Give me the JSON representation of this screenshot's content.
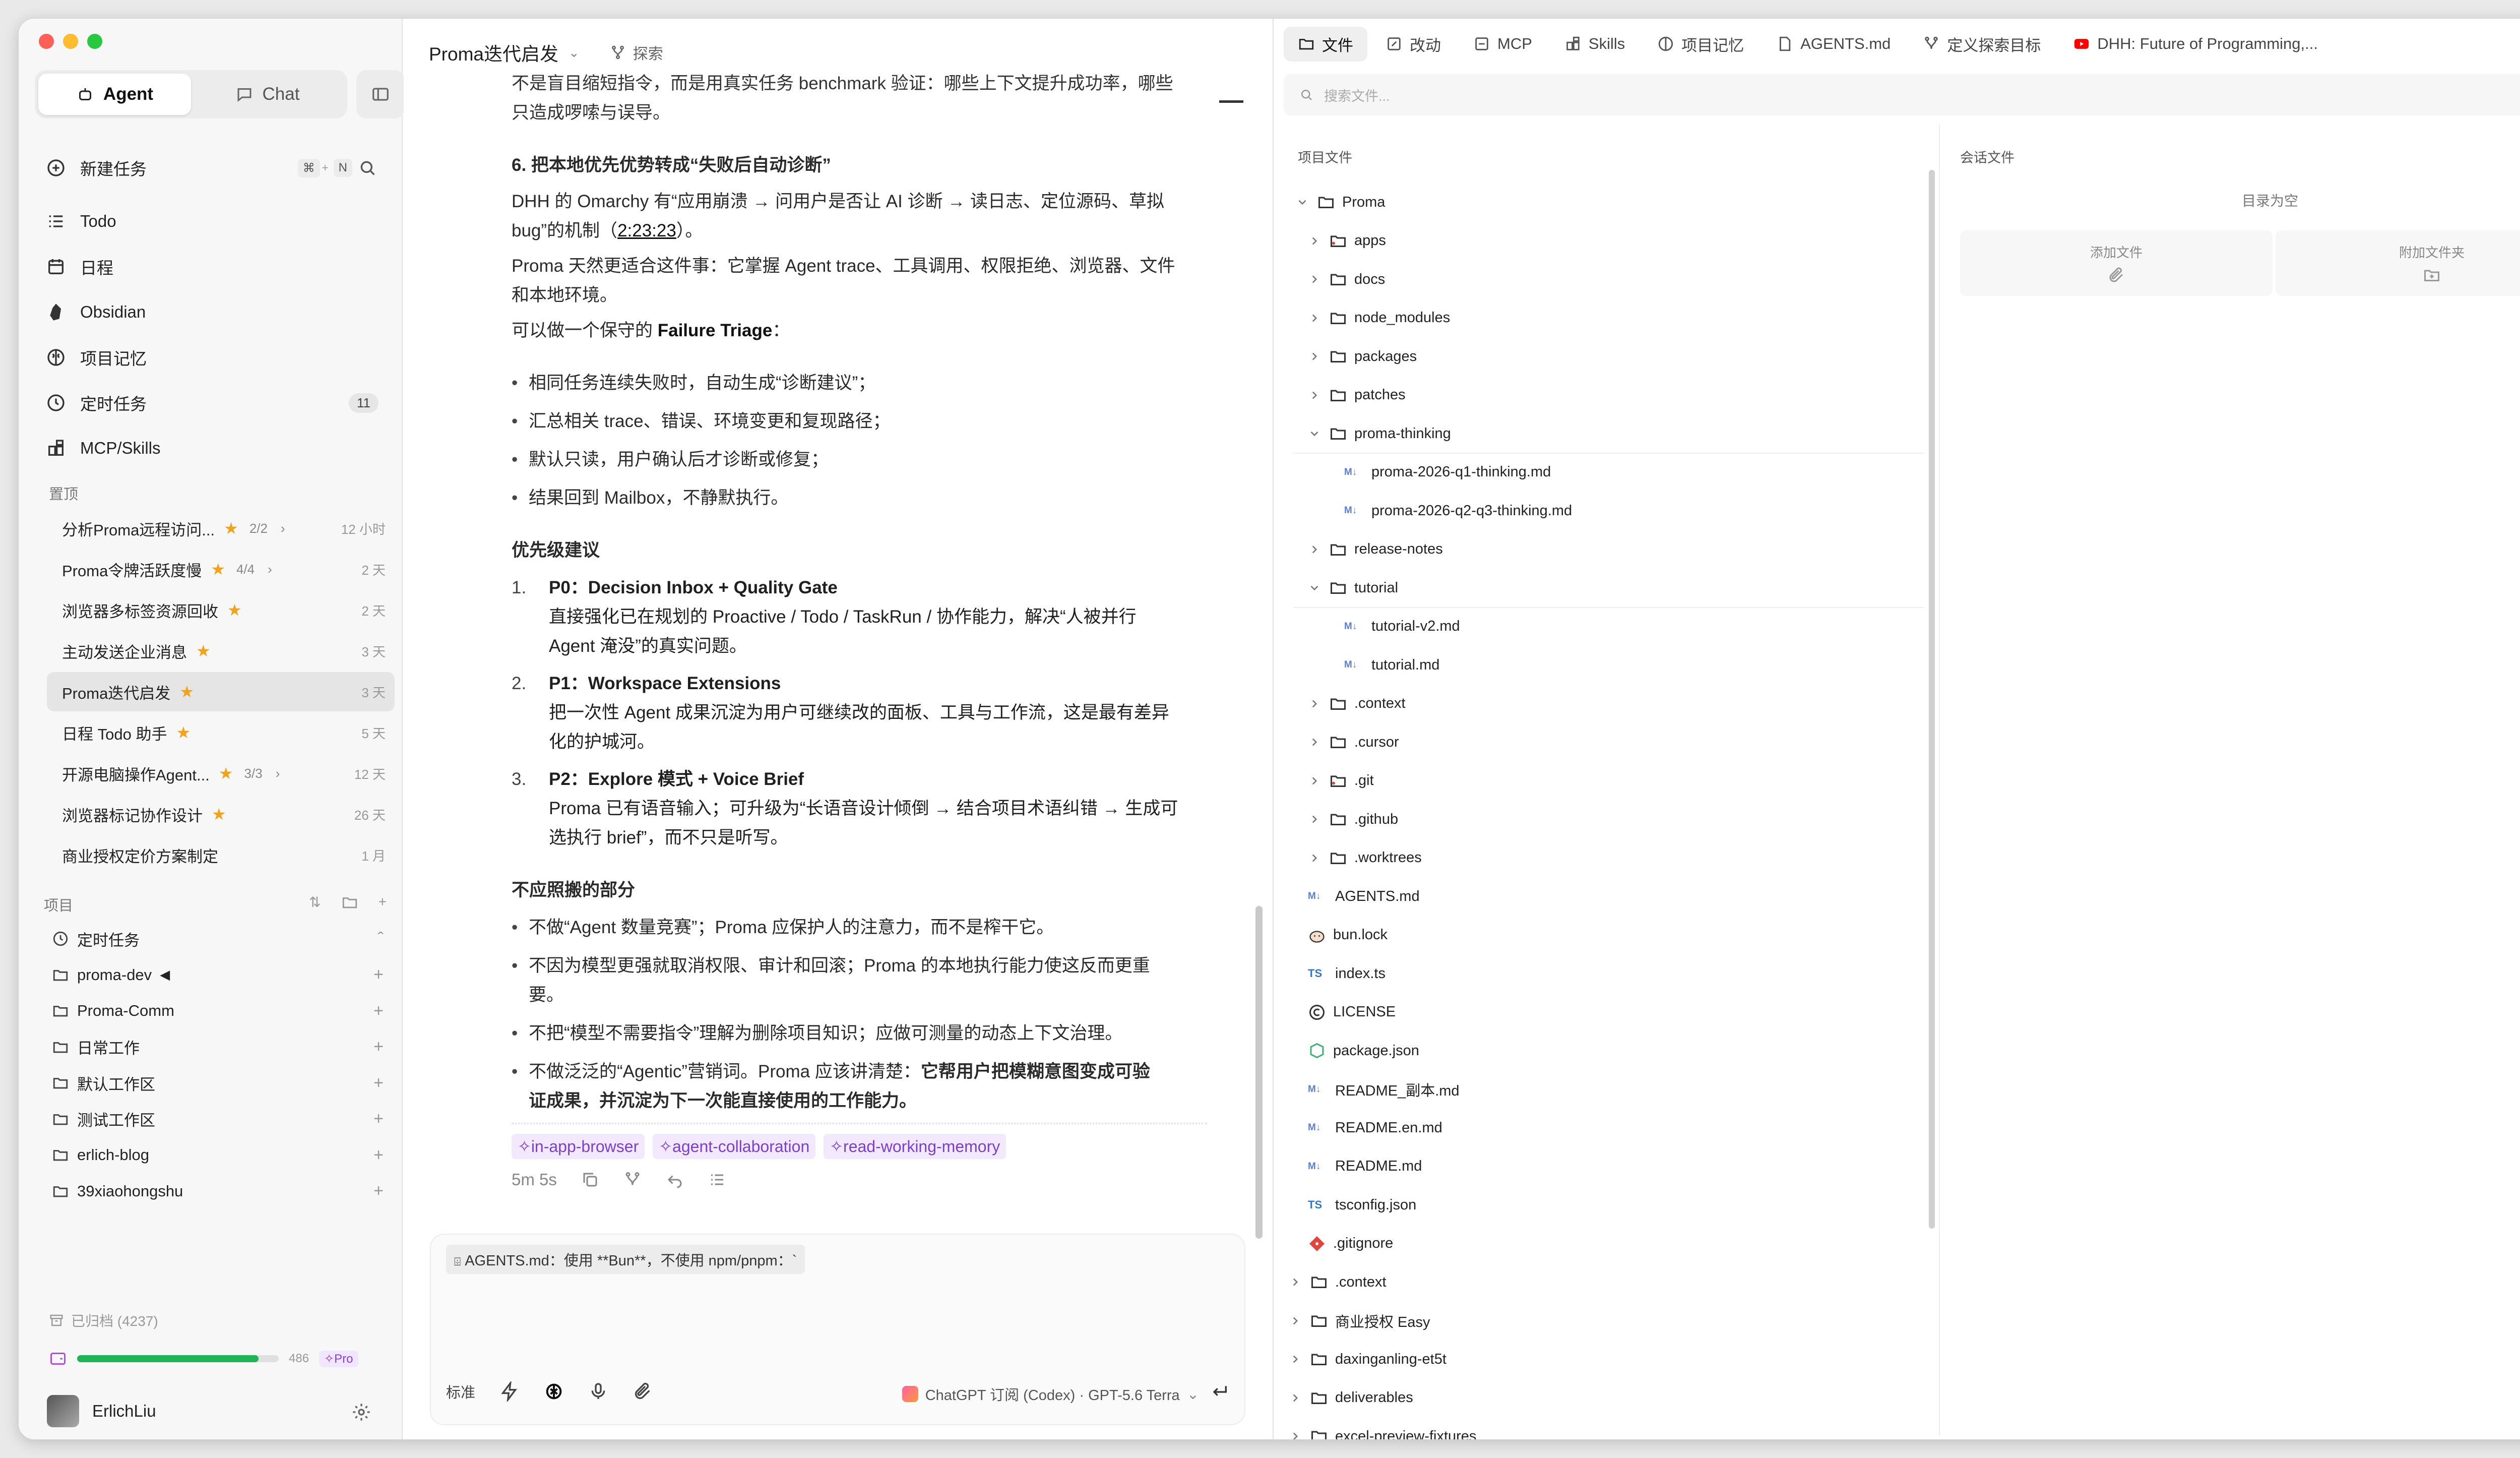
{
  "sidebar": {
    "tabs": {
      "agent": "Agent",
      "chat": "Chat"
    },
    "new_task": "新建任务",
    "kbd1": "⌘",
    "kbd_plus": "+",
    "kbd2": "N",
    "nav": [
      "Todo",
      "日程",
      "Obsidian",
      "项目记忆",
      "定时任务",
      "MCP/Skills"
    ],
    "timer_badge": "11",
    "pinned_title": "置顶",
    "pinned": [
      {
        "label": "分析Proma远程访问...",
        "star": true,
        "count": "2/2",
        "chev": true,
        "time": "12 小时"
      },
      {
        "label": "Proma令牌活跃度慢",
        "star": true,
        "count": "4/4",
        "chev": true,
        "time": "2 天"
      },
      {
        "label": "浏览器多标签资源回收",
        "star": true,
        "count": "",
        "chev": false,
        "time": "2 天"
      },
      {
        "label": "主动发送企业消息",
        "star": true,
        "count": "",
        "chev": false,
        "time": "3 天"
      },
      {
        "label": "Proma迭代启发",
        "star": true,
        "count": "",
        "chev": false,
        "time": "3 天"
      },
      {
        "label": "日程 Todo 助手",
        "star": true,
        "count": "",
        "chev": false,
        "time": "5 天"
      },
      {
        "label": "开源电脑操作Agent...",
        "star": true,
        "count": "3/3",
        "chev": true,
        "time": "12 天"
      },
      {
        "label": "浏览器标记协作设计",
        "star": true,
        "count": "",
        "chev": false,
        "time": "26 天"
      },
      {
        "label": "商业授权定价方案制定",
        "star": false,
        "count": "",
        "chev": false,
        "time": "1 月"
      }
    ],
    "projects_title": "项目",
    "projects": [
      "定时任务",
      "proma-dev",
      "Proma-Comm",
      "日常工作",
      "默认工作区",
      "测试工作区",
      "erlich-blog",
      "39xiaohongshu"
    ],
    "archived": "已归档 (4237)",
    "usage": "486",
    "usage_progress": 0.9,
    "pro": "Pro",
    "user": "ErlichLiu"
  },
  "chat": {
    "title": "Proma迭代启发",
    "explore": "探索",
    "top_line1": "不是盲目缩短指令，而是用真实任务 benchmark 验证：哪些上下文提升成功率，哪些",
    "top_line2": "只造成啰嗦与误导。",
    "h6": "6. 把本地优先优势转成“失败后自动诊断”",
    "p1_a": "DHH 的 Omarchy 有“应用崩溃 → 问用户是否让 AI 诊断 → 读日志、定位源码、草拟",
    "p1_b": "bug”的机制（",
    "p1_link": "2:23:23",
    "p1_c": "）。",
    "p2_a": "Proma 天然更适合这件事：它掌握 Agent trace、工具调用、权限拒绝、浏览器、文件",
    "p2_b": "和本地环境。",
    "p3_a": "可以做一个保守的 ",
    "p3_b": "Failure Triage",
    "p3_c": "：",
    "bullets1": [
      "相同任务连续失败时，自动生成“诊断建议”；",
      "汇总相关 trace、错误、环境变更和复现路径；",
      "默认只读，用户确认后才诊断或修复；",
      "结果回到 Mailbox，不静默执行。"
    ],
    "priority_title": "优先级建议",
    "priorities": [
      {
        "n": "1.",
        "title": "P0：Decision Inbox + Quality Gate",
        "l1": "直接强化已在规划的 Proactive / Todo / TaskRun / 协作能力，解决“人被并行",
        "l2": "Agent 淹没”的真实问题。"
      },
      {
        "n": "2.",
        "title": "P1：Workspace Extensions",
        "l1": "把一次性 Agent 成果沉淀为用户可继续改的面板、工具与工作流，这是最有差异",
        "l2": "化的护城河。"
      },
      {
        "n": "3.",
        "title": "P2：Explore 模式 + Voice Brief",
        "l1": "Proma 已有语音输入；可升级为“长语音设计倾倒 → 结合项目术语纠错 → 生成可",
        "l2": "选执行 brief”，而不只是听写。"
      }
    ],
    "avoid_title": "不应照搬的部分",
    "avoid": [
      {
        "l1": "不做“Agent 数量竞赛”；Proma 应保护人的注意力，而不是榨干它。",
        "l2": ""
      },
      {
        "l1": "不因为模型更强就取消权限、审计和回滚；Proma 的本地执行能力使这反而更重",
        "l2": "要。"
      },
      {
        "l1": "不把“模型不需要指令”理解为删除项目知识；应做可测量的动态上下文治理。",
        "l2": ""
      }
    ],
    "last_a": "不做泛泛的“Agentic”营销词。Proma 应该讲清楚：",
    "last_b": "它帮用户把模糊意图变成可验",
    "last_c": "证成果，并沉淀为下一次能直接使用的工作能力。",
    "tags": [
      "in-app-browser",
      "agent-collaboration",
      "read-working-memory"
    ],
    "duration": "5m 5s",
    "input_chip": "AGENTS.md：使用 **Bun**，不使用 npm/pnpm：`",
    "mode": "标准",
    "model": "ChatGPT 订阅 (Codex) · GPT-5.6 Terra"
  },
  "right": {
    "tabs": [
      "文件",
      "改动",
      "MCP",
      "Skills",
      "项目记忆",
      "AGENTS.md",
      "定义探索目标",
      "DHH: Future of Programming,..."
    ],
    "search_placeholder": "搜索文件...",
    "project_files": "项目文件",
    "session_files": "会话文件",
    "empty": "目录为空",
    "add_file": "添加文件",
    "attach_folder": "附加文件夹",
    "tree": [
      {
        "name": "Proma",
        "level": 0,
        "type": "folder",
        "open": true
      },
      {
        "name": "apps",
        "level": 1,
        "type": "folder-red"
      },
      {
        "name": "docs",
        "level": 1,
        "type": "folder"
      },
      {
        "name": "node_modules",
        "level": 1,
        "type": "folder"
      },
      {
        "name": "packages",
        "level": 1,
        "type": "folder"
      },
      {
        "name": "patches",
        "level": 1,
        "type": "folder"
      },
      {
        "name": "proma-thinking",
        "level": 1,
        "type": "folder",
        "open": true
      },
      {
        "name": "proma-2026-q1-thinking.md",
        "level": 2,
        "type": "md"
      },
      {
        "name": "proma-2026-q2-q3-thinking.md",
        "level": 2,
        "type": "md"
      },
      {
        "name": "release-notes",
        "level": 1,
        "type": "folder"
      },
      {
        "name": "tutorial",
        "level": 1,
        "type": "folder",
        "open": true
      },
      {
        "name": "tutorial-v2.md",
        "level": 2,
        "type": "md"
      },
      {
        "name": "tutorial.md",
        "level": 2,
        "type": "md"
      },
      {
        "name": ".context",
        "level": 1,
        "type": "folder"
      },
      {
        "name": ".cursor",
        "level": 1,
        "type": "folder"
      },
      {
        "name": ".git",
        "level": 1,
        "type": "folder-red"
      },
      {
        "name": ".github",
        "level": 1,
        "type": "folder"
      },
      {
        "name": ".worktrees",
        "level": 1,
        "type": "folder"
      },
      {
        "name": "AGENTS.md",
        "level": 1,
        "type": "md",
        "leaf": true
      },
      {
        "name": "bun.lock",
        "level": 1,
        "type": "bun",
        "leaf": true
      },
      {
        "name": "index.ts",
        "level": 1,
        "type": "ts",
        "leaf": true
      },
      {
        "name": "LICENSE",
        "level": 1,
        "type": "lic",
        "leaf": true
      },
      {
        "name": "package.json",
        "level": 1,
        "type": "json",
        "leaf": true
      },
      {
        "name": "README_副本.md",
        "level": 1,
        "type": "md",
        "leaf": true
      },
      {
        "name": "README.en.md",
        "level": 1,
        "type": "md",
        "leaf": true
      },
      {
        "name": "README.md",
        "level": 1,
        "type": "md",
        "leaf": true
      },
      {
        "name": "tsconfig.json",
        "level": 1,
        "type": "ts",
        "leaf": true
      },
      {
        "name": ".gitignore",
        "level": 1,
        "type": "git",
        "leaf": true
      },
      {
        "name": ".context",
        "level": 0,
        "type": "folder"
      },
      {
        "name": "商业授权 Easy",
        "level": 0,
        "type": "folder"
      },
      {
        "name": "daxinganling-et5t",
        "level": 0,
        "type": "folder"
      },
      {
        "name": "deliverables",
        "level": 0,
        "type": "folder"
      },
      {
        "name": "excel-preview-fixtures",
        "level": 0,
        "type": "folder"
      }
    ]
  }
}
